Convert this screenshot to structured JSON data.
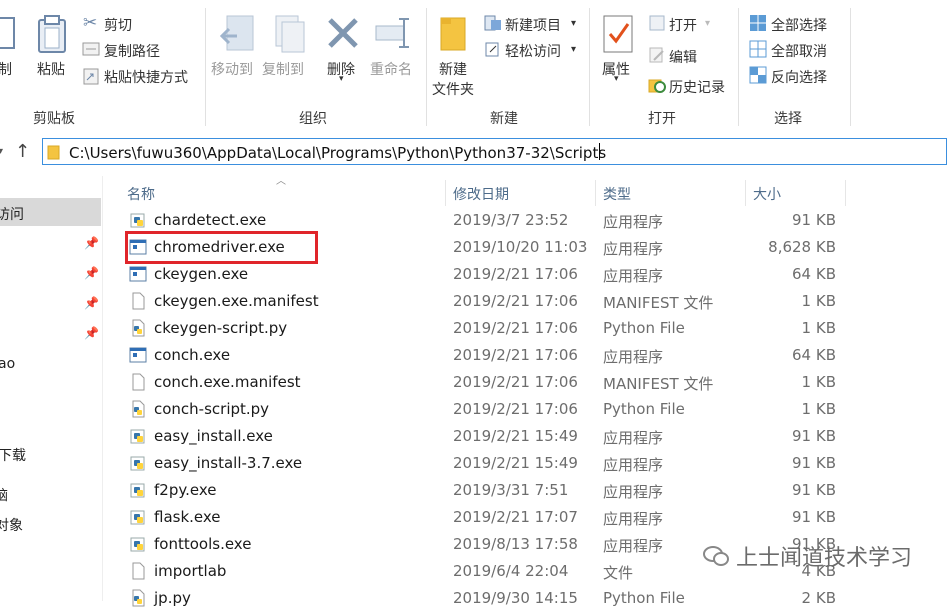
{
  "ribbon": {
    "clipboard": {
      "copy_partial": "制",
      "paste": "粘贴",
      "cut": "剪切",
      "copy_path": "复制路径",
      "paste_shortcut": "粘贴快捷方式",
      "label": "剪贴板"
    },
    "organize": {
      "move_to": "移动到",
      "copy_to": "复制到",
      "delete": "删除",
      "rename": "重命名",
      "label": "组织"
    },
    "new": {
      "new_folder_l1": "新建",
      "new_folder_l2": "文件夹",
      "new_item": "新建项目",
      "easy_access": "轻松访问",
      "label": "新建"
    },
    "open": {
      "properties": "属性",
      "open": "打开",
      "edit": "编辑",
      "history": "历史记录",
      "label": "打开"
    },
    "select": {
      "select_all": "全部选择",
      "select_none": "全部取消",
      "invert": "反向选择",
      "label": "选择"
    }
  },
  "address": {
    "path": "C:\\Users\\fuwu360\\AppData\\Local\\Programs\\Python\\Python37-32\\Scripts"
  },
  "nav": [
    "访问",
    "ao",
    "下载",
    "脑",
    "对象"
  ],
  "columns": {
    "name": "名称",
    "date": "修改日期",
    "type": "类型",
    "size": "大小"
  },
  "files": [
    {
      "name": "chardetect.exe",
      "date": "2019/3/7 23:52",
      "type": "应用程序",
      "size": "91 KB",
      "icon": "python-exe-icon"
    },
    {
      "name": "chromedriver.exe",
      "date": "2019/10/20 11:03",
      "type": "应用程序",
      "size": "8,628 KB",
      "icon": "app-exe-icon"
    },
    {
      "name": "ckeygen.exe",
      "date": "2019/2/21 17:06",
      "type": "应用程序",
      "size": "64 KB",
      "icon": "app-exe-icon"
    },
    {
      "name": "ckeygen.exe.manifest",
      "date": "2019/2/21 17:06",
      "type": "MANIFEST 文件",
      "size": "1 KB",
      "icon": "blank-file-icon"
    },
    {
      "name": "ckeygen-script.py",
      "date": "2019/2/21 17:06",
      "type": "Python File",
      "size": "1 KB",
      "icon": "python-file-icon"
    },
    {
      "name": "conch.exe",
      "date": "2019/2/21 17:06",
      "type": "应用程序",
      "size": "64 KB",
      "icon": "app-exe-icon"
    },
    {
      "name": "conch.exe.manifest",
      "date": "2019/2/21 17:06",
      "type": "MANIFEST 文件",
      "size": "1 KB",
      "icon": "blank-file-icon"
    },
    {
      "name": "conch-script.py",
      "date": "2019/2/21 17:06",
      "type": "Python File",
      "size": "1 KB",
      "icon": "python-file-icon"
    },
    {
      "name": "easy_install.exe",
      "date": "2019/2/21 15:49",
      "type": "应用程序",
      "size": "91 KB",
      "icon": "python-exe-icon"
    },
    {
      "name": "easy_install-3.7.exe",
      "date": "2019/2/21 15:49",
      "type": "应用程序",
      "size": "91 KB",
      "icon": "python-exe-icon"
    },
    {
      "name": "f2py.exe",
      "date": "2019/3/31 7:51",
      "type": "应用程序",
      "size": "91 KB",
      "icon": "python-exe-icon"
    },
    {
      "name": "flask.exe",
      "date": "2019/2/21 17:07",
      "type": "应用程序",
      "size": "91 KB",
      "icon": "python-exe-icon"
    },
    {
      "name": "fonttools.exe",
      "date": "2019/8/13 17:58",
      "type": "应用程序",
      "size": "91 KB",
      "icon": "python-exe-icon"
    },
    {
      "name": "importlab",
      "date": "2019/6/4 22:04",
      "type": "文件",
      "size": "4 KB",
      "icon": "blank-file-icon"
    },
    {
      "name": "jp.py",
      "date": "2019/9/30 14:15",
      "type": "Python File",
      "size": "2 KB",
      "icon": "python-file-icon"
    }
  ],
  "watermark": "上士闻道技术学习",
  "colors": {
    "highlight": "#e0252a",
    "address_border": "#3b8fde"
  }
}
